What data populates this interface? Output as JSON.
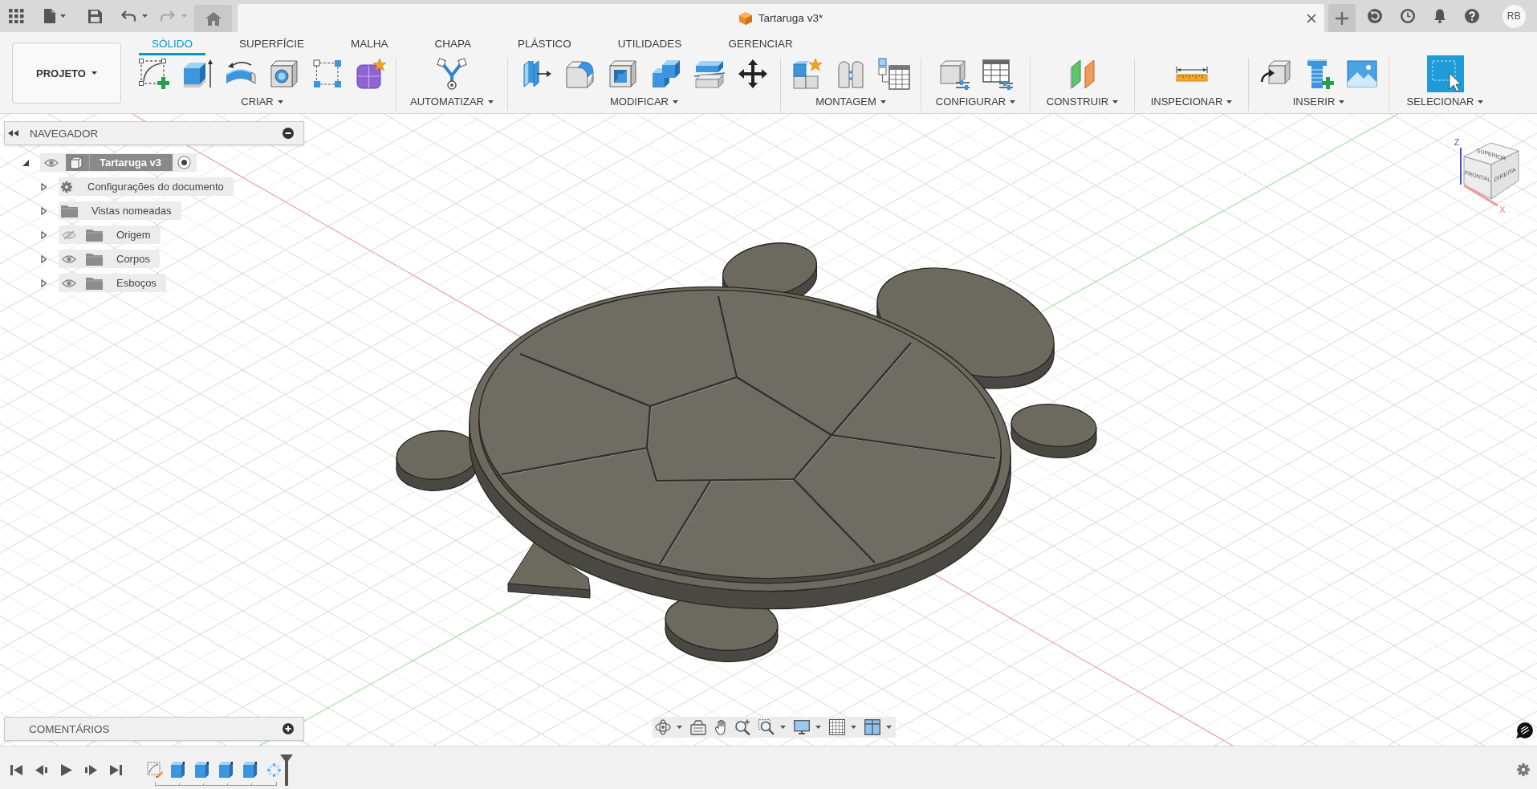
{
  "title_bar": {
    "undo": {
      "disabled": false
    },
    "redo": {
      "disabled": true
    },
    "document_tab": {
      "title": "Tartaruga v3*"
    },
    "user": {
      "initials": "RB"
    }
  },
  "toolbar": {
    "project_button": {
      "label": "PROJETO"
    },
    "tabs": [
      {
        "label": "SÓLIDO",
        "selected": true
      },
      {
        "label": "SUPERFÍCIE",
        "selected": false
      },
      {
        "label": "MALHA",
        "selected": false
      },
      {
        "label": "CHAPA",
        "selected": false
      },
      {
        "label": "PLÁSTICO",
        "selected": false
      },
      {
        "label": "UTILIDADES",
        "selected": false
      },
      {
        "label": "GERENCIAR",
        "selected": false
      }
    ],
    "groups": [
      {
        "label": "CRIAR"
      },
      {
        "label": "AUTOMATIZAR"
      },
      {
        "label": "MODIFICAR"
      },
      {
        "label": "MONTAGEM"
      },
      {
        "label": "CONFIGURAR"
      },
      {
        "label": "CONSTRUIR"
      },
      {
        "label": "INSPECIONAR"
      },
      {
        "label": "INSERIR"
      },
      {
        "label": "SELECIONAR"
      }
    ]
  },
  "navigator": {
    "title": "NAVEGADOR",
    "tree": [
      {
        "label": "Tartaruga v3",
        "expanded": true,
        "visible": true,
        "active": true,
        "children": [
          {
            "kind": "settings",
            "label": "Configurações do documento",
            "expanded": false
          },
          {
            "kind": "views",
            "label": "Vistas nomeadas",
            "expanded": false
          },
          {
            "kind": "folder",
            "label": "Origem",
            "expanded": false,
            "visible": false
          },
          {
            "kind": "folder",
            "label": "Corpos",
            "expanded": false,
            "visible": true
          },
          {
            "kind": "folder",
            "label": "Esboços",
            "expanded": false,
            "visible": true
          }
        ]
      }
    ]
  },
  "view_cube": {
    "faces": [
      "SUPERIOR",
      "FRONTAL",
      "DIREITA"
    ],
    "axes": [
      "Z",
      "X"
    ]
  },
  "comments": {
    "title": "COMENTÁRIOS"
  }
}
